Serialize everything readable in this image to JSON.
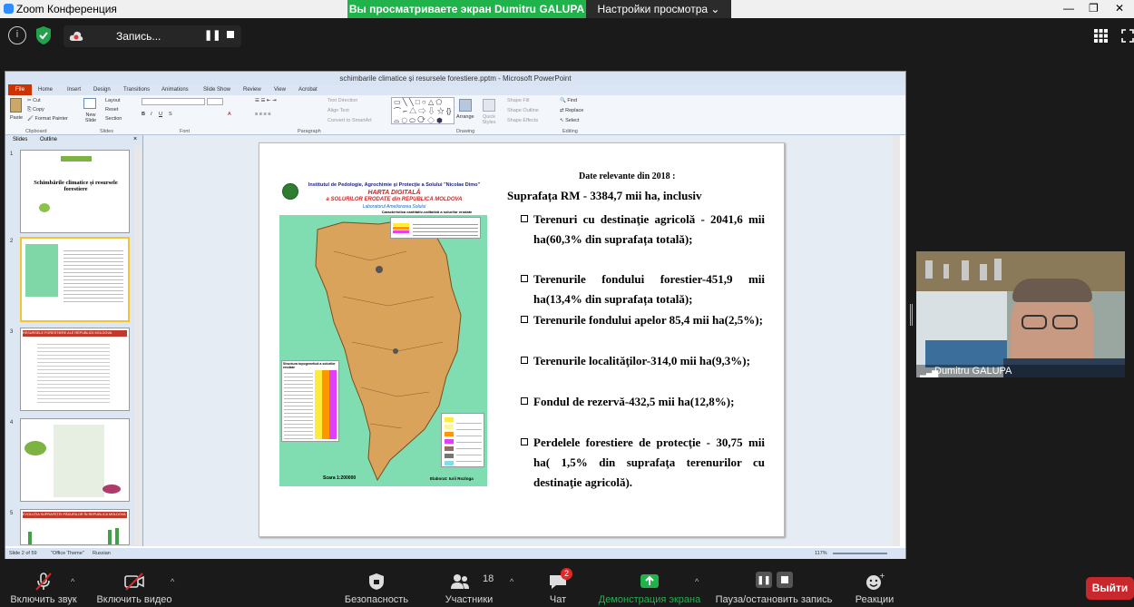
{
  "zoom": {
    "window_title": "Zoom Конференция",
    "share_banner": "Вы просматриваете экран Dumitru GALUPA",
    "view_settings": "Настройки просмотра",
    "recording_label": "Запись...",
    "colors": {
      "share_green": "#20b24b",
      "leave_red": "#c8272b",
      "toolbar_bg": "#1a1a1a"
    }
  },
  "ppt": {
    "title": "schimbarile climatice și resursele forestiere.pptm - Microsoft PowerPoint",
    "file_tab": "File",
    "tabs": [
      "Home",
      "Insert",
      "Design",
      "Transitions",
      "Animations",
      "Slide Show",
      "Review",
      "View",
      "Acrobat"
    ],
    "ribbon": {
      "clipboard": {
        "paste": "Paste",
        "cut": "Cut",
        "copy": "Copy",
        "format_painter": "Format Painter",
        "group": "Clipboard"
      },
      "slides": {
        "new_slide": "New Slide",
        "layout": "Layout",
        "reset": "Reset",
        "section": "Section",
        "group": "Slides"
      },
      "font_group": "Font",
      "paragraph": {
        "text_direction": "Text Direction",
        "align_text": "Align Text",
        "convert_smartart": "Convert to SmartArt",
        "group": "Paragraph"
      },
      "drawing": {
        "arrange": "Arrange",
        "quick_styles": "Quick Styles",
        "shape_fill": "Shape Fill",
        "shape_outline": "Shape Outline",
        "shape_effects": "Shape Effects",
        "group": "Drawing"
      },
      "editing": {
        "find": "Find",
        "replace": "Replace",
        "select": "Select",
        "group": "Editing"
      }
    },
    "pane_tabs": [
      "Slides",
      "Outline"
    ],
    "thumbnails": [
      {
        "num": "1",
        "title": "Schimbările climatice și resursele forestiere"
      },
      {
        "num": "2",
        "title": ""
      },
      {
        "num": "3",
        "title": "RESURSELE FORESTIERE ALE REPUBLICII MOLDOVA"
      },
      {
        "num": "4",
        "title": ""
      },
      {
        "num": "5",
        "title": "EVOLUȚIA SUPRAFEȚEI PĂDURILOR ÎN REPUBLICA MOLDOVA"
      }
    ],
    "status": {
      "slide_of": "Slide 2 of 59",
      "theme": "\"Office Theme\"",
      "language": "Russian",
      "zoom": "117%"
    }
  },
  "slide": {
    "heading": "Date relevante din  2018 :",
    "subheading": "Suprafața RM - 3384,7 mii ha, inclusiv",
    "map": {
      "institute": "Institutul de Pedologie, Agrochimie şi Protecţie a Solului \"Nicolae Dimo\"",
      "title_line1": "HARTA DIGITALĂ",
      "title_line2": "a  SOLURILOR ERODATE din REPUBLICA MOLDOVA",
      "lab": "Laboratorul  Ameliorarea Solului",
      "table_caption": "Caracteristica cantitativ-calitativă a solurilor erodate",
      "structure_title": "Structura topogenetică a solurilor erodate",
      "scale": "Scara 1:200000",
      "author": "Elaborat: Iurii Rozloga"
    },
    "bullets": [
      "Terenuri cu destinaţie agricolă - 2041,6 mii ha(60,3% din suprafața totală);",
      "Terenurile fondului forestier-451,9 mii ha(13,4% din suprafața totală);",
      "Terenurile fondului apelor 85,4 mii ha(2,5%);",
      "Terenurile localităţilor-314,0 mii ha(9,3%);",
      "Fondul de rezervă-432,5 mii ha(12,8%);",
      "Perdelele forestiere de protecţie - 30,75 mii ha( 1,5% din suprafaţa terenurilor cu destinaţie agricolă)."
    ]
  },
  "webcam": {
    "name": "Dumitru GALUPA"
  },
  "toolbar": {
    "unmute": "Включить звук",
    "start_video": "Включить видео",
    "security": "Безопасность",
    "participants": "Участники",
    "participants_count": "18",
    "chat": "Чат",
    "chat_badge": "2",
    "share": "Демонстрация экрана",
    "pause_share": "Пауза/остановить запись",
    "reactions": "Реакции",
    "leave": "Выйти"
  }
}
